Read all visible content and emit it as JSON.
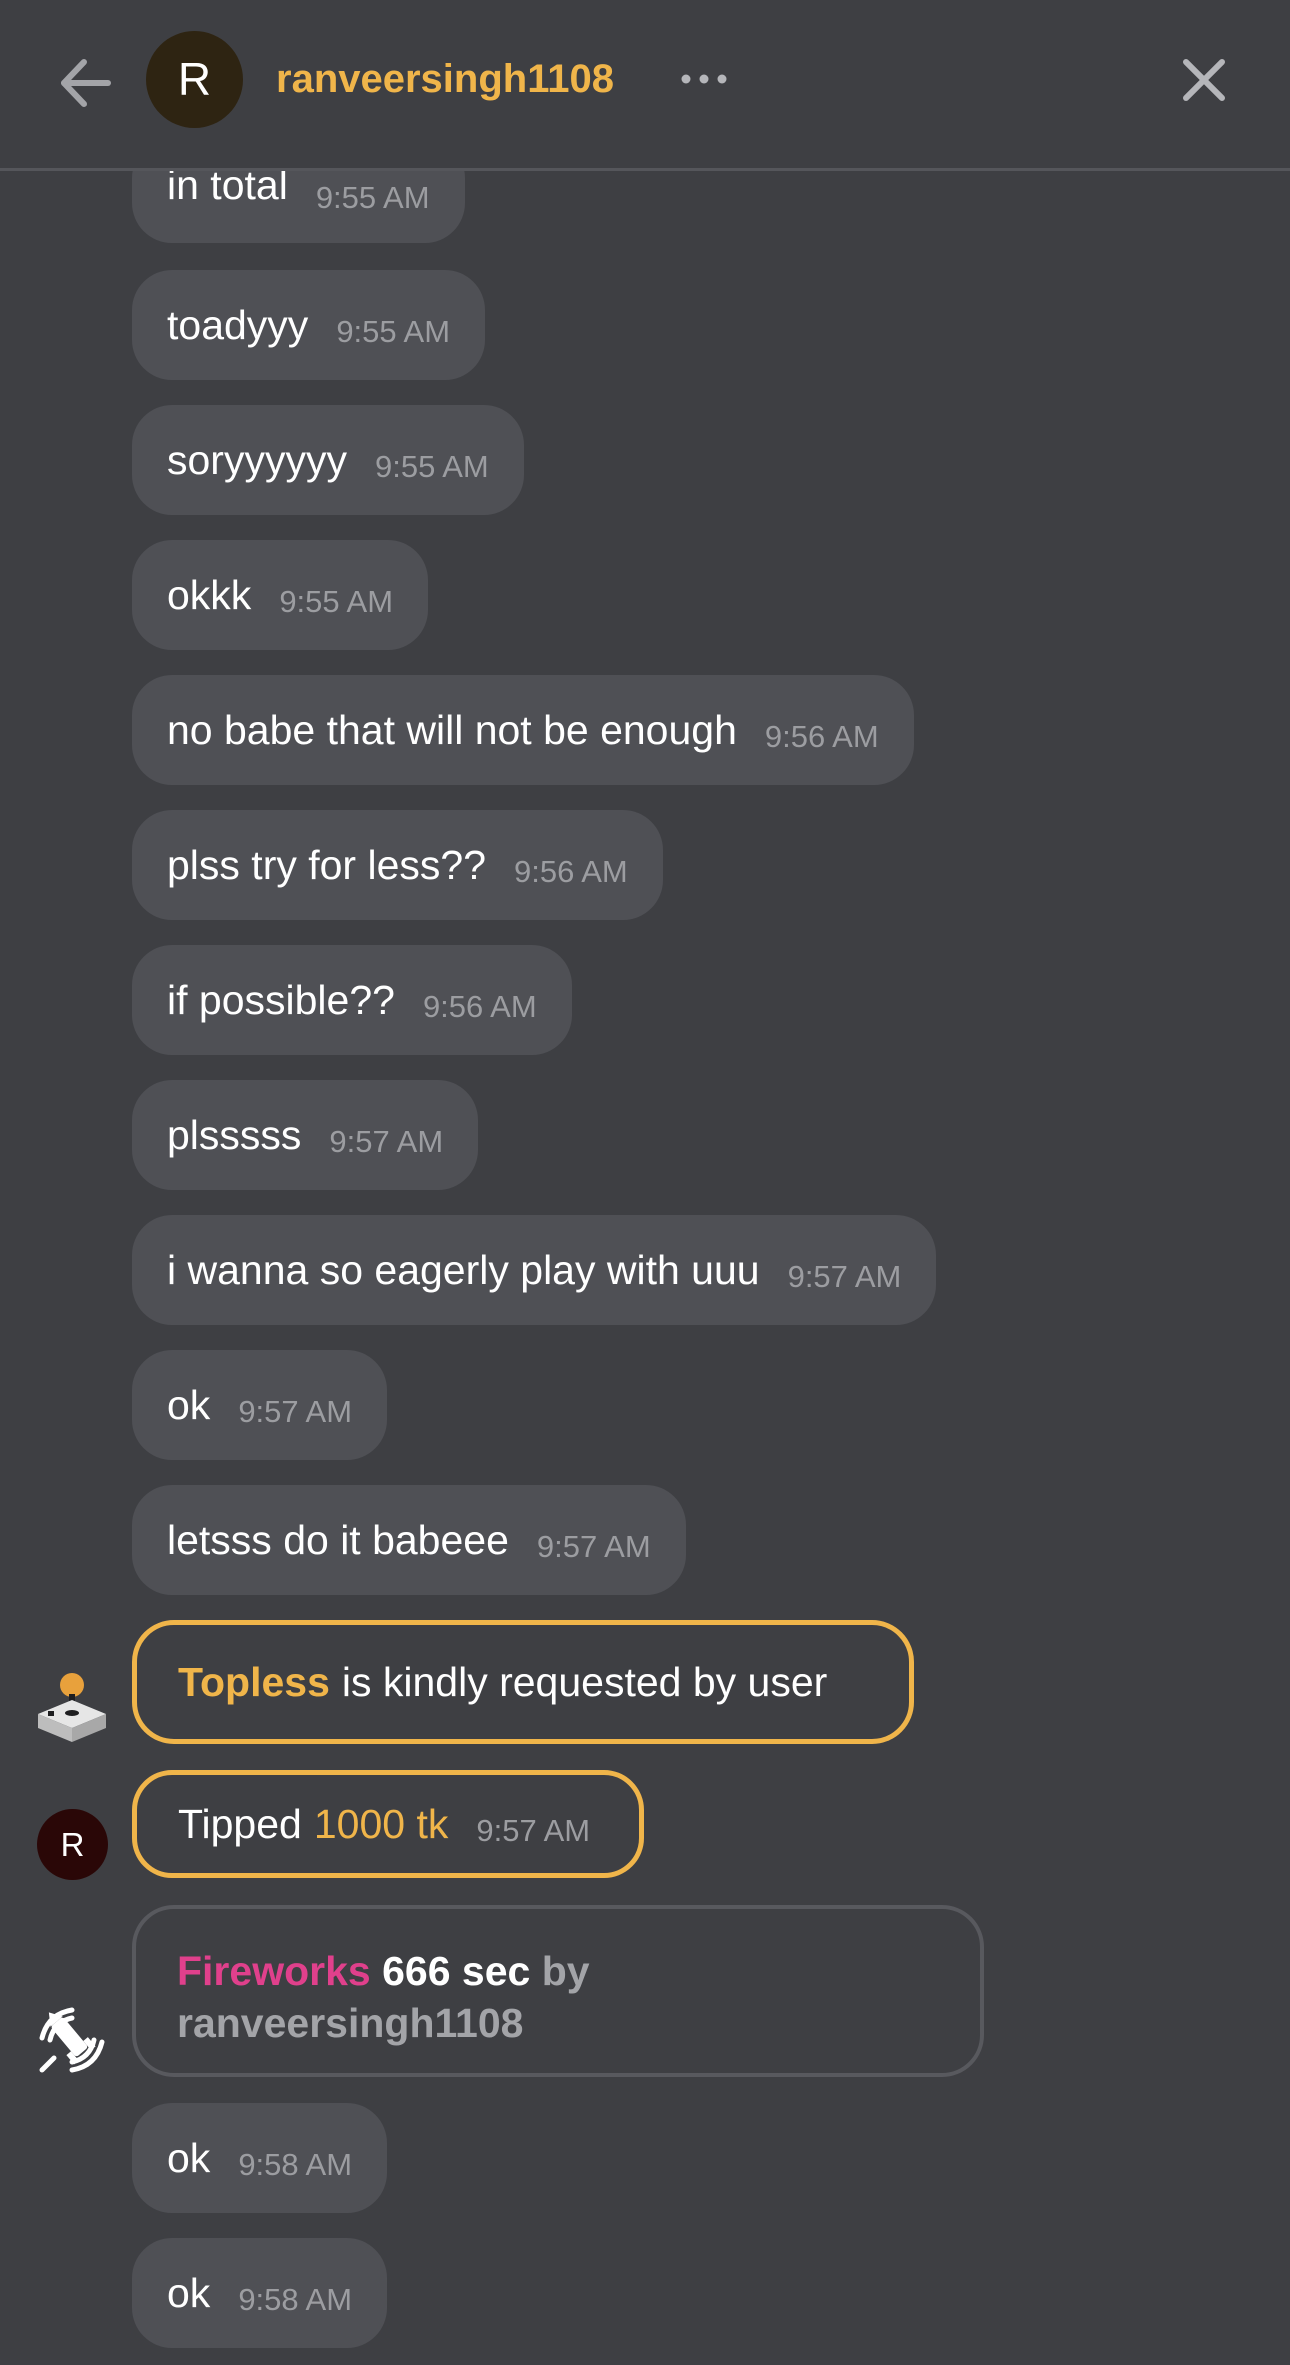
{
  "header": {
    "avatar_initial": "R",
    "username": "ranveersingh1108",
    "more_label": "more-options",
    "back_icon": "arrow-left-icon",
    "close_icon": "close-icon"
  },
  "messages": [
    {
      "text": "in total",
      "time": "9:55 AM"
    },
    {
      "text": "toadyyy",
      "time": "9:55 AM"
    },
    {
      "text": "soryyyyyy",
      "time": "9:55 AM"
    },
    {
      "text": "okkk",
      "time": "9:55 AM"
    },
    {
      "text": "no babe that will not be enough",
      "time": "9:56 AM"
    },
    {
      "text": "plss try for less??",
      "time": "9:56 AM"
    },
    {
      "text": "if possible??",
      "time": "9:56 AM"
    },
    {
      "text": "plsssss",
      "time": "9:57 AM"
    },
    {
      "text": "i wanna so eagerly play with uuu",
      "time": "9:57 AM"
    },
    {
      "text": "ok",
      "time": "9:57 AM"
    },
    {
      "text": "letsss do it babeee",
      "time": "9:57 AM"
    }
  ],
  "request": {
    "item": "Topless",
    "text": "is kindly requested by user",
    "icon": "joystick-icon"
  },
  "tip": {
    "avatar_initial": "R",
    "label": "Tipped",
    "amount": "1000 tk",
    "time": "9:57 AM"
  },
  "fireworks": {
    "name": "Fireworks",
    "duration": "666 sec",
    "by": "by",
    "user": "ranveersingh1108",
    "icon": "fireworks-rocket-icon"
  },
  "messages_after": [
    {
      "text": "ok",
      "time": "9:58 AM"
    },
    {
      "text": "ok",
      "time": "9:58 AM"
    }
  ],
  "colors": {
    "background": "#3e3f43",
    "bubble": "#4f5055",
    "accent": "#f0b54a",
    "fireworks": "#e0408c"
  }
}
